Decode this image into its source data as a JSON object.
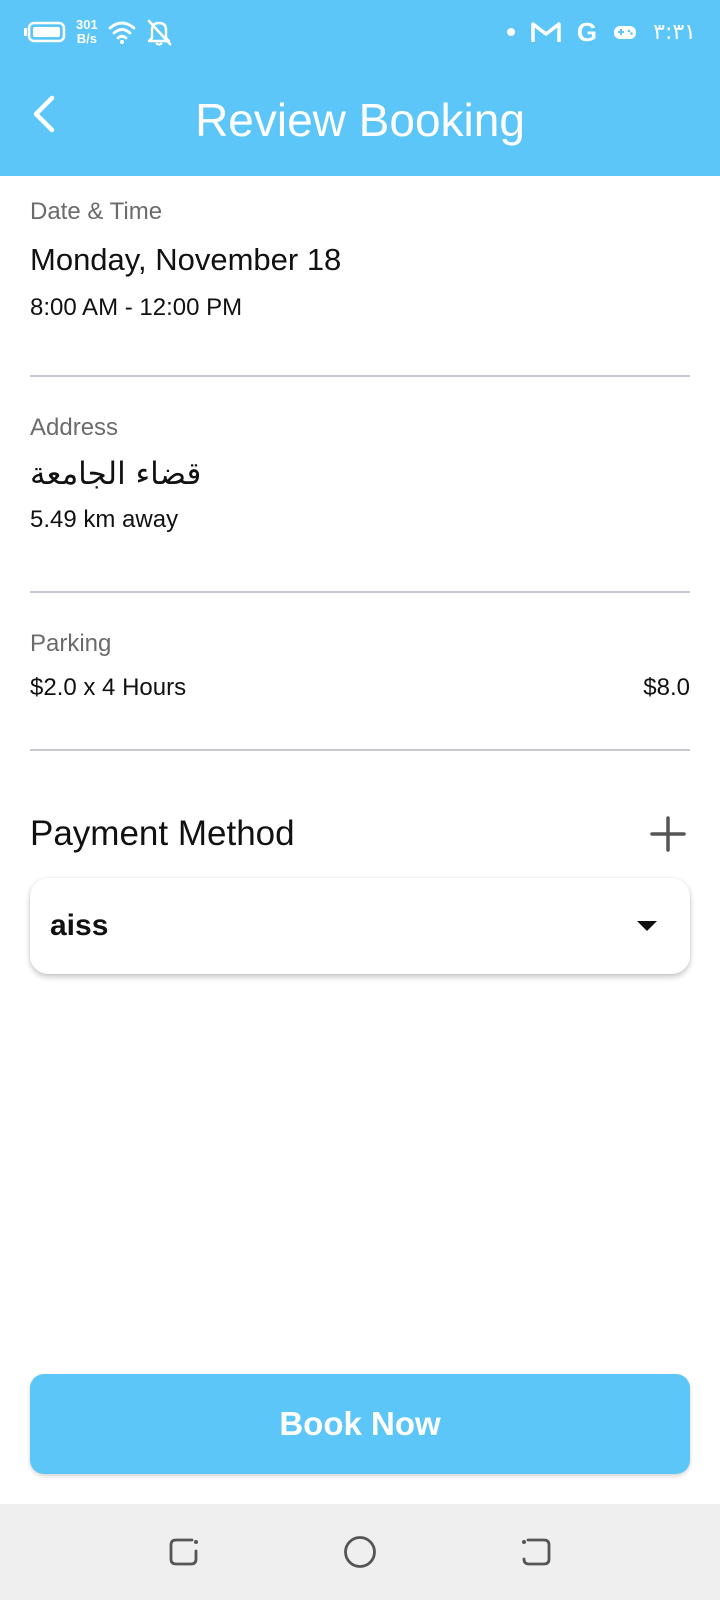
{
  "status_bar": {
    "net_speed_value": "301",
    "net_speed_unit": "B/s",
    "time": "٣:٣١",
    "icons": [
      "battery-icon",
      "wifi-icon",
      "notifications-off-icon",
      "dot-icon",
      "gmail-icon",
      "google-icon",
      "game-icon"
    ]
  },
  "header": {
    "title": "Review Booking",
    "back_icon": "chevron-left-icon"
  },
  "date_time": {
    "label": "Date & Time",
    "date": "Monday, November 18",
    "time_range": "8:00 AM - 12:00 PM"
  },
  "address": {
    "label": "Address",
    "name": "قضاء الجامعة",
    "distance": "5.49 km away"
  },
  "parking": {
    "label": "Parking",
    "rate": "$2.0 x 4 Hours",
    "total": "$8.0"
  },
  "payment": {
    "title": "Payment Method",
    "add_icon": "plus-icon",
    "selected": "aiss",
    "dropdown_icon": "dropdown-arrow-icon"
  },
  "actions": {
    "book_label": "Book Now"
  },
  "nav_bar": {
    "icons": [
      "recent-apps-icon",
      "home-icon",
      "back-icon"
    ]
  },
  "colors": {
    "accent": "#5cc6f8",
    "divider": "#c6c6d2",
    "label_gray": "#6b6b6b",
    "nav_bg": "#efefef"
  }
}
